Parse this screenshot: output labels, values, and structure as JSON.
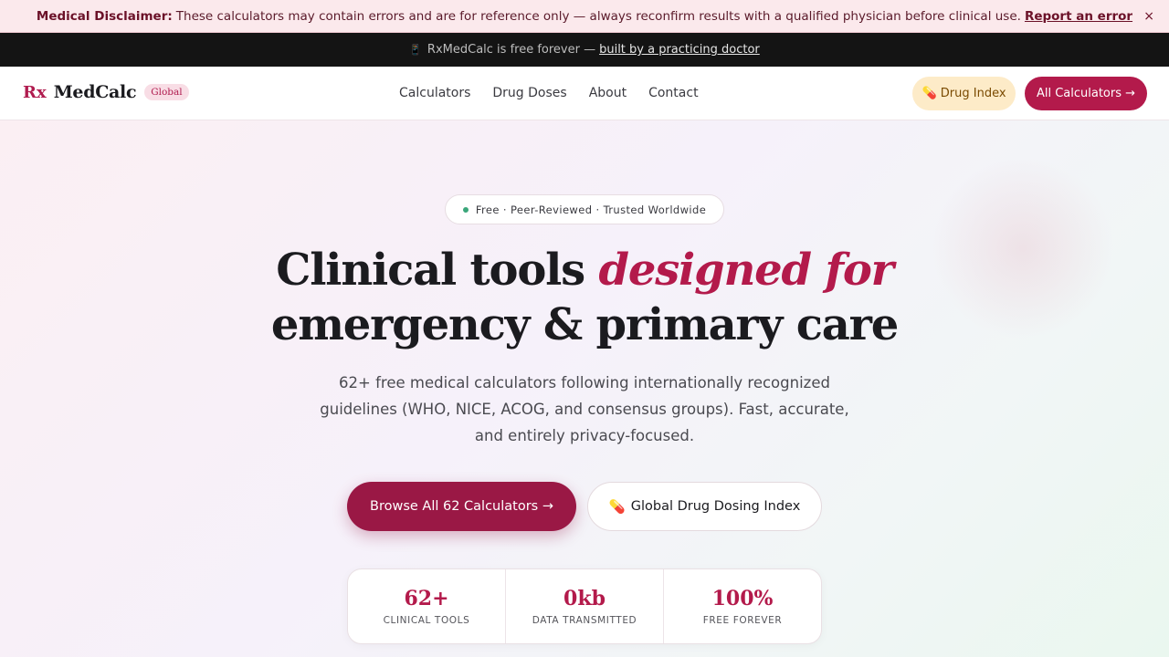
{
  "disclaimer": {
    "label": "Medical Disclaimer:",
    "text": "These calculators may contain errors and are for reference only — always reconfirm results with a qualified physician before clinical use.",
    "link": "Report an error",
    "close": "×"
  },
  "freebar": {
    "icon": "phone-icon",
    "text": "RxMedCalc is free forever —",
    "link": "built by a practicing doctor"
  },
  "nav": {
    "logo_rx": "Rx",
    "logo_name": "MedCalc",
    "logo_badge": "Global",
    "links": [
      "Calculators",
      "Drug Doses",
      "About",
      "Contact"
    ],
    "drug_index_btn": "💊 Drug Index",
    "all_calcs_btn": "All Calculators →"
  },
  "hero": {
    "pill": "Free · Peer-Reviewed · Trusted Worldwide",
    "title_part1": "Clinical tools ",
    "title_accent": "designed for",
    "title_line2": "emergency & primary care",
    "subtitle": "62+ free medical calculators following internationally recognized guidelines (WHO, NICE, ACOG, and consensus groups). Fast, accurate, and entirely privacy-focused.",
    "cta_primary": "Browse All 62 Calculators →",
    "cta_secondary": "Global Drug Dosing Index",
    "cta_secondary_icon": "💊"
  },
  "stats": [
    {
      "value": "62+",
      "label": "CLINICAL TOOLS"
    },
    {
      "value": "0kb",
      "label": "DATA TRANSMITTED"
    },
    {
      "value": "100%",
      "label": "FREE FOREVER"
    }
  ],
  "colors": {
    "brand": "#b31a4b",
    "disclaimer_bg": "#fbe9ec",
    "freebar_bg": "#141414"
  }
}
